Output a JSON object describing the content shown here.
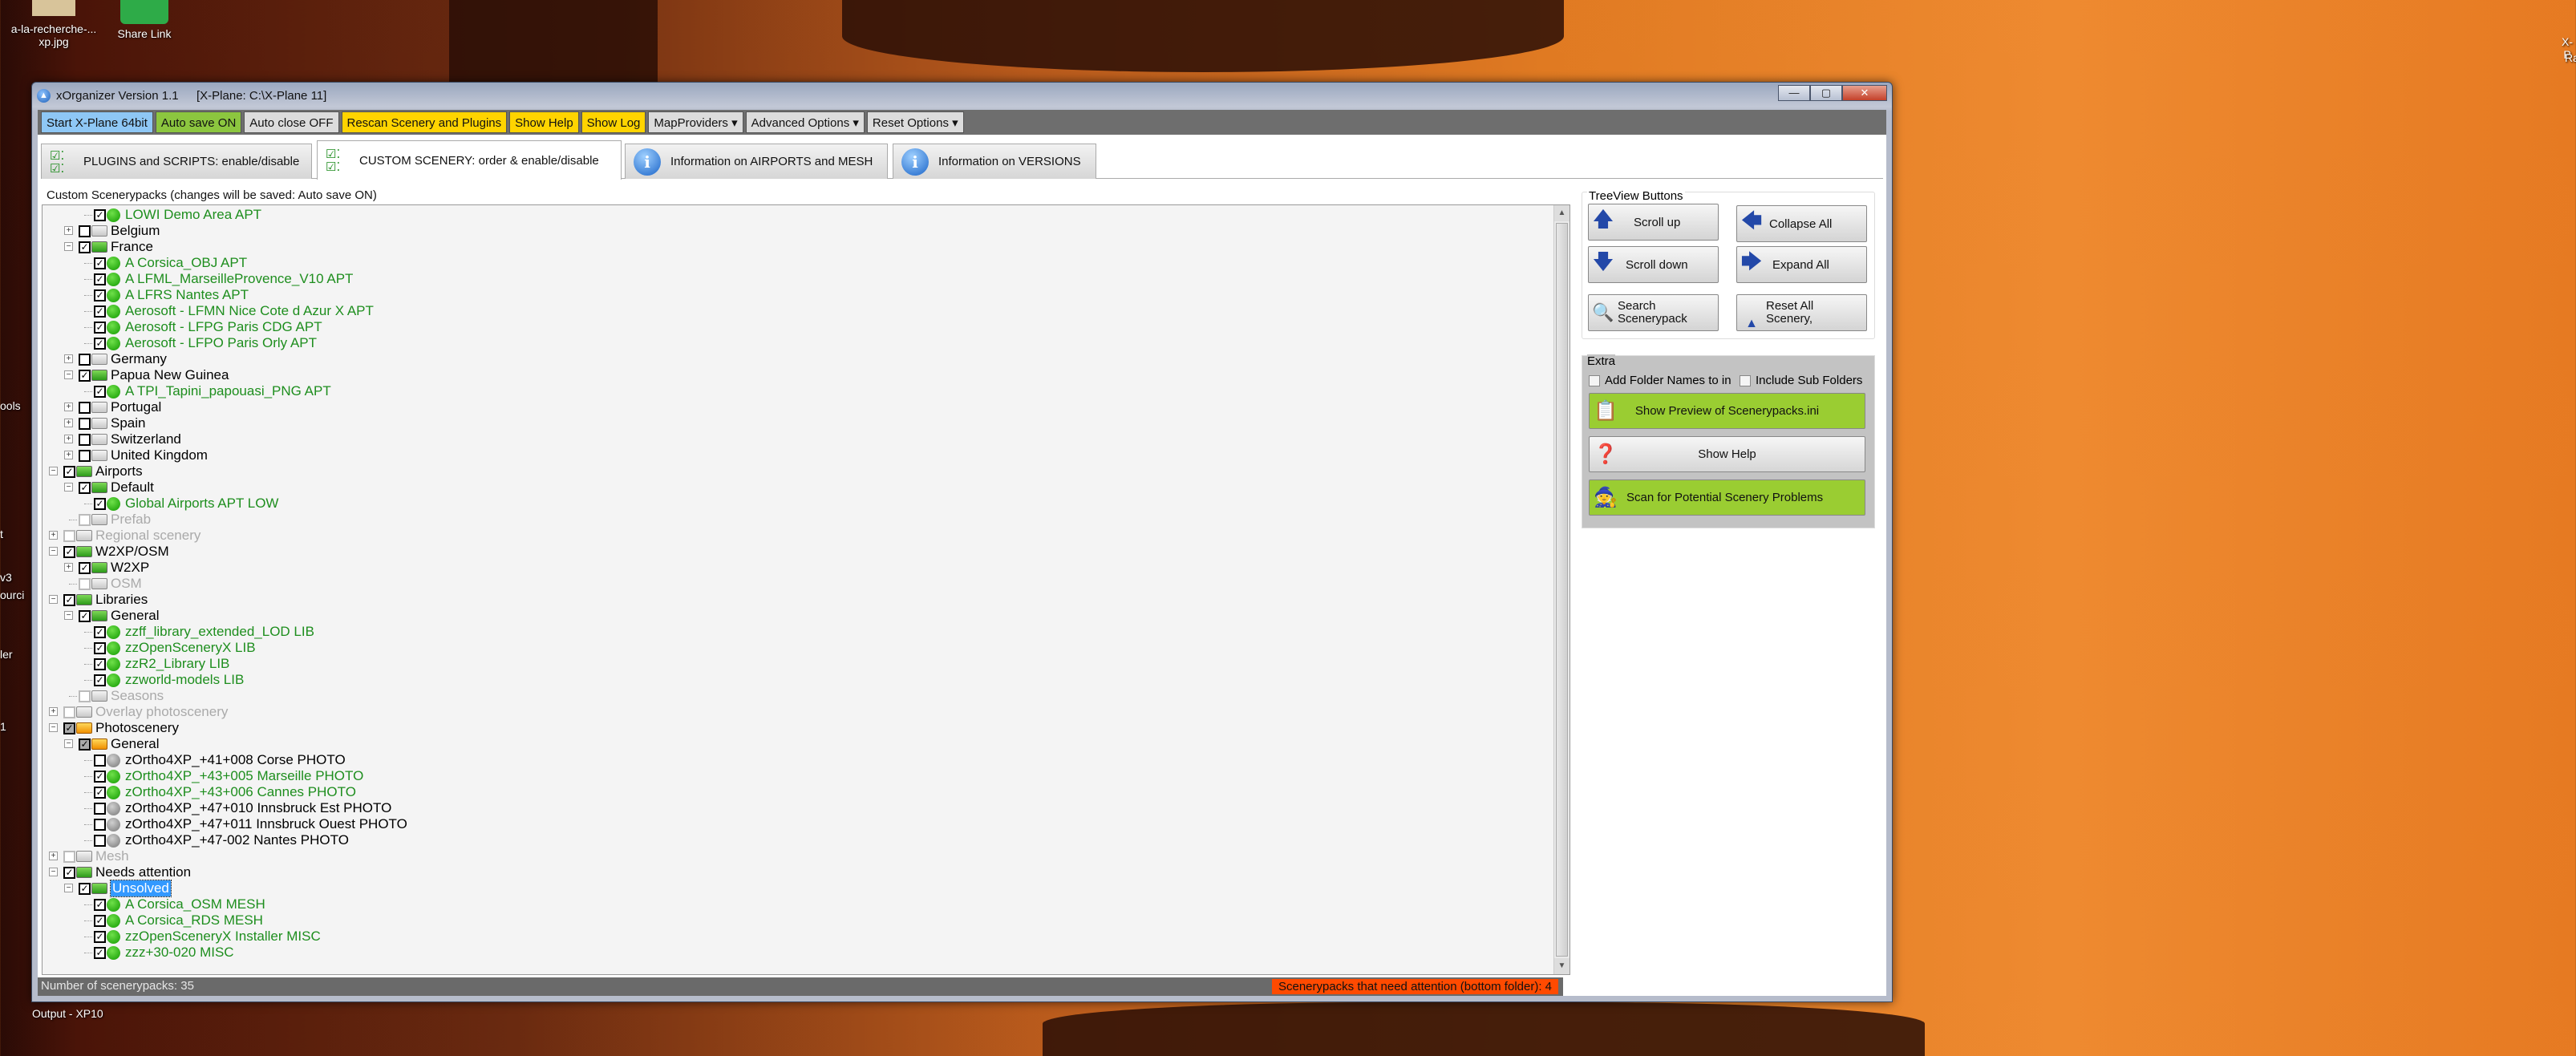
{
  "desktop": {
    "icons": [
      {
        "label": "a-la-recherche-...\nxp.jpg"
      },
      {
        "label": "Share Link"
      }
    ],
    "left_fragments": [
      "ools",
      "t",
      "v3",
      "ourci",
      "ler",
      "1"
    ],
    "bottom_label": "Output - XP10",
    "right_fragments": [
      "X-P",
      "Ra"
    ]
  },
  "window": {
    "title": "xOrganizer Version 1.1",
    "path": "[X-Plane: C:\\X-Plane 11]",
    "controls": {
      "minimize": "—",
      "maximize": "▢",
      "close": "✕"
    }
  },
  "toolbar": [
    {
      "label": "Start X-Plane 64bit",
      "color": "blue"
    },
    {
      "label": "Auto save ON",
      "color": "green"
    },
    {
      "label": "Auto close OFF",
      "color": "gray"
    },
    {
      "label": "Rescan Scenery and Plugins",
      "color": "yellow"
    },
    {
      "label": "Show Help",
      "color": "yellow"
    },
    {
      "label": "Show Log",
      "color": "yellow"
    },
    {
      "label": "MapProviders ▾",
      "color": "gray"
    },
    {
      "label": "Advanced Options ▾",
      "color": "gray"
    },
    {
      "label": "Reset Options ▾",
      "color": "gray"
    }
  ],
  "tabs": [
    {
      "label": "PLUGINS and SCRIPTS: enable/disable",
      "icon": "checklist-icon",
      "active": false
    },
    {
      "label": "CUSTOM SCENERY: order & enable/disable",
      "icon": "checklist-icon",
      "active": true
    },
    {
      "label": "Information on AIRPORTS and MESH",
      "icon": "info-icon",
      "active": false
    },
    {
      "label": "Information on VERSIONS",
      "icon": "info-icon",
      "active": false
    }
  ],
  "tree": {
    "group_label": "Custom Scenerypacks (changes will be saved: Auto save ON)",
    "rows": [
      {
        "label": "LOWI Demo Area APT",
        "level": 2,
        "exp": "",
        "check": "on",
        "icon": "dot-green",
        "style": "green"
      },
      {
        "label": "Belgium",
        "level": 1,
        "exp": "+",
        "check": "off",
        "icon": "folder-gray",
        "style": "black"
      },
      {
        "label": "France",
        "level": 1,
        "exp": "-",
        "check": "on",
        "icon": "folder-green",
        "style": "black"
      },
      {
        "label": "A Corsica_OBJ APT",
        "level": 2,
        "exp": "",
        "check": "on",
        "icon": "dot-green",
        "style": "green"
      },
      {
        "label": "A LFML_MarseilleProvence_V10 APT",
        "level": 2,
        "exp": "",
        "check": "on",
        "icon": "dot-green",
        "style": "green"
      },
      {
        "label": "A LFRS Nantes APT",
        "level": 2,
        "exp": "",
        "check": "on",
        "icon": "dot-green",
        "style": "green"
      },
      {
        "label": "Aerosoft - LFMN Nice Cote d Azur X APT",
        "level": 2,
        "exp": "",
        "check": "on",
        "icon": "dot-green",
        "style": "green"
      },
      {
        "label": "Aerosoft - LFPG Paris CDG APT",
        "level": 2,
        "exp": "",
        "check": "on",
        "icon": "dot-green",
        "style": "green"
      },
      {
        "label": "Aerosoft - LFPO Paris Orly APT",
        "level": 2,
        "exp": "",
        "check": "on",
        "icon": "dot-green",
        "style": "green"
      },
      {
        "label": "Germany",
        "level": 1,
        "exp": "+",
        "check": "off",
        "icon": "folder-gray",
        "style": "black"
      },
      {
        "label": "Papua New Guinea",
        "level": 1,
        "exp": "-",
        "check": "on",
        "icon": "folder-green",
        "style": "black"
      },
      {
        "label": "A TPI_Tapini_papouasi_PNG APT",
        "level": 2,
        "exp": "",
        "check": "on",
        "icon": "dot-green",
        "style": "green"
      },
      {
        "label": "Portugal",
        "level": 1,
        "exp": "+",
        "check": "off",
        "icon": "folder-gray",
        "style": "black"
      },
      {
        "label": "Spain",
        "level": 1,
        "exp": "+",
        "check": "off",
        "icon": "folder-gray",
        "style": "black"
      },
      {
        "label": "Switzerland",
        "level": 1,
        "exp": "+",
        "check": "off",
        "icon": "folder-gray",
        "style": "black"
      },
      {
        "label": "United Kingdom",
        "level": 1,
        "exp": "+",
        "check": "off",
        "icon": "folder-gray",
        "style": "black"
      },
      {
        "label": "Airports",
        "level": 0,
        "exp": "-",
        "check": "on",
        "icon": "folder-green",
        "style": "black"
      },
      {
        "label": "Default",
        "level": 1,
        "exp": "-",
        "check": "on",
        "icon": "folder-green",
        "style": "black"
      },
      {
        "label": "Global Airports APT LOW",
        "level": 2,
        "exp": "",
        "check": "on",
        "icon": "dot-green",
        "style": "green"
      },
      {
        "label": "Prefab",
        "level": 1,
        "exp": "",
        "check": "dis",
        "icon": "folder-gray",
        "style": "gray"
      },
      {
        "label": "Regional scenery",
        "level": 0,
        "exp": "+",
        "check": "dis",
        "icon": "folder-gray",
        "style": "gray"
      },
      {
        "label": "W2XP/OSM",
        "level": 0,
        "exp": "-",
        "check": "on",
        "icon": "folder-green",
        "style": "black"
      },
      {
        "label": "W2XP",
        "level": 1,
        "exp": "+",
        "check": "on",
        "icon": "folder-green",
        "style": "black"
      },
      {
        "label": "OSM",
        "level": 1,
        "exp": "",
        "check": "dis",
        "icon": "folder-gray",
        "style": "gray"
      },
      {
        "label": "Libraries",
        "level": 0,
        "exp": "-",
        "check": "on",
        "icon": "folder-green",
        "style": "black"
      },
      {
        "label": "General",
        "level": 1,
        "exp": "-",
        "check": "on",
        "icon": "folder-green",
        "style": "black"
      },
      {
        "label": "zzff_library_extended_LOD LIB",
        "level": 2,
        "exp": "",
        "check": "on",
        "icon": "dot-green",
        "style": "green"
      },
      {
        "label": "zzOpenSceneryX LIB",
        "level": 2,
        "exp": "",
        "check": "on",
        "icon": "dot-green",
        "style": "green"
      },
      {
        "label": "zzR2_Library LIB",
        "level": 2,
        "exp": "",
        "check": "on",
        "icon": "dot-green",
        "style": "green"
      },
      {
        "label": "zzworld-models LIB",
        "level": 2,
        "exp": "",
        "check": "on",
        "icon": "dot-green",
        "style": "green"
      },
      {
        "label": "Seasons",
        "level": 1,
        "exp": "",
        "check": "dis",
        "icon": "folder-gray",
        "style": "gray"
      },
      {
        "label": "Overlay photoscenery",
        "level": 0,
        "exp": "+",
        "check": "dis",
        "icon": "folder-gray",
        "style": "gray"
      },
      {
        "label": "Photoscenery",
        "level": 0,
        "exp": "-",
        "check": "partial",
        "icon": "folder-orange",
        "style": "black"
      },
      {
        "label": "General",
        "level": 1,
        "exp": "-",
        "check": "partial",
        "icon": "folder-orange",
        "style": "black"
      },
      {
        "label": "zOrtho4XP_+41+008 Corse PHOTO",
        "level": 2,
        "exp": "",
        "check": "off",
        "icon": "dot-gray",
        "style": "black"
      },
      {
        "label": "zOrtho4XP_+43+005 Marseille PHOTO",
        "level": 2,
        "exp": "",
        "check": "on",
        "icon": "dot-green",
        "style": "green"
      },
      {
        "label": "zOrtho4XP_+43+006 Cannes PHOTO",
        "level": 2,
        "exp": "",
        "check": "on",
        "icon": "dot-green",
        "style": "green"
      },
      {
        "label": "zOrtho4XP_+47+010 Innsbruck Est PHOTO",
        "level": 2,
        "exp": "",
        "check": "off",
        "icon": "dot-gray",
        "style": "black"
      },
      {
        "label": "zOrtho4XP_+47+011 Innsbruck Ouest PHOTO",
        "level": 2,
        "exp": "",
        "check": "off",
        "icon": "dot-gray",
        "style": "black"
      },
      {
        "label": "zOrtho4XP_+47-002 Nantes PHOTO",
        "level": 2,
        "exp": "",
        "check": "off",
        "icon": "dot-gray",
        "style": "black"
      },
      {
        "label": "Mesh",
        "level": 0,
        "exp": "+",
        "check": "dis",
        "icon": "folder-gray",
        "style": "gray"
      },
      {
        "label": "Needs attention",
        "level": 0,
        "exp": "-",
        "check": "on",
        "icon": "folder-green",
        "style": "black"
      },
      {
        "label": "Unsolved",
        "level": 1,
        "exp": "-",
        "check": "on",
        "icon": "folder-green",
        "style": "selected"
      },
      {
        "label": "A Corsica_OSM MESH",
        "level": 2,
        "exp": "",
        "check": "on",
        "icon": "dot-green",
        "style": "green"
      },
      {
        "label": "A Corsica_RDS MESH",
        "level": 2,
        "exp": "",
        "check": "on",
        "icon": "dot-green",
        "style": "green"
      },
      {
        "label": "zzOpenSceneryX Installer MISC",
        "level": 2,
        "exp": "",
        "check": "on",
        "icon": "dot-green",
        "style": "green"
      },
      {
        "label": "zzz+30-020 MISC",
        "level": 2,
        "exp": "",
        "check": "on",
        "icon": "dot-green",
        "style": "green"
      }
    ]
  },
  "status": {
    "count": "Number of scenerypacks: 35",
    "attention": "Scenerypacks that need attention (bottom folder): 4",
    "attention_color": "#ff4a00"
  },
  "treeview_buttons": {
    "label": "TreeView Buttons",
    "scroll_up": "Scroll up",
    "collapse_all": "Collapse All",
    "scroll_down": "Scroll down",
    "expand_all": "Expand All",
    "search_1": "Search",
    "search_2": "Scenerypack",
    "reset_1": "Reset All",
    "reset_2": "Scenery,"
  },
  "extra": {
    "label": "Extra",
    "add_folder_names": "Add Folder Names to in",
    "include_sub_folders": "Include Sub Folders",
    "show_preview": "Show Preview of Scenerypacks.ini",
    "show_help": "Show Help",
    "scan": "Scan for Potential Scenery Problems",
    "accent": "#9acd32"
  }
}
